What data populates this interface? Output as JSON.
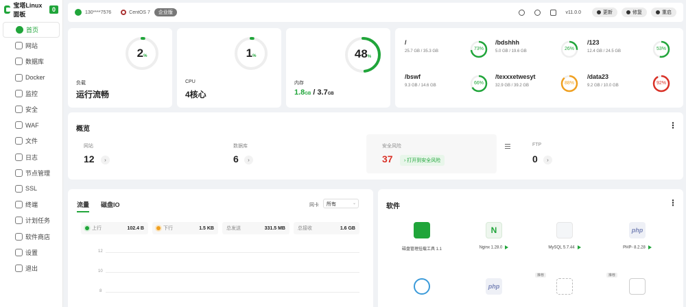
{
  "brand": {
    "name": "宝塔Linux面板",
    "badge": "0"
  },
  "sidebar": {
    "items": [
      {
        "label": "首页",
        "icon": "home-icon"
      },
      {
        "label": "网站",
        "icon": "website-icon"
      },
      {
        "label": "数据库",
        "icon": "database-icon"
      },
      {
        "label": "Docker",
        "icon": "docker-icon"
      },
      {
        "label": "监控",
        "icon": "monitor-icon"
      },
      {
        "label": "安全",
        "icon": "shield-icon"
      },
      {
        "label": "WAF",
        "icon": "waf-icon"
      },
      {
        "label": "文件",
        "icon": "file-icon"
      },
      {
        "label": "日志",
        "icon": "log-icon"
      },
      {
        "label": "节点管理",
        "icon": "node-icon"
      },
      {
        "label": "SSL",
        "icon": "ssl-icon"
      },
      {
        "label": "终端",
        "icon": "terminal-icon"
      },
      {
        "label": "计划任务",
        "icon": "calendar-icon"
      },
      {
        "label": "软件商店",
        "icon": "store-icon"
      },
      {
        "label": "设置",
        "icon": "gear-icon"
      },
      {
        "label": "退出",
        "icon": "logout-icon"
      }
    ]
  },
  "topbar": {
    "user": "130****7576",
    "os": "CentOS 7",
    "edition": "企业版",
    "version": "v11.0.0",
    "update_label": "更新",
    "repair_label": "修复",
    "restart_label": "重启"
  },
  "stats": {
    "load": {
      "percent": 2,
      "label": "负载",
      "status": "运行流畅"
    },
    "cpu": {
      "percent": 1,
      "label": "CPU",
      "cores": "4核心"
    },
    "memory": {
      "percent": 48,
      "label": "内存",
      "used": "1.8",
      "used_unit": "GB",
      "total": "3.7",
      "total_unit": "GB",
      "sep": " / "
    },
    "percent_sign": "%"
  },
  "disks": [
    {
      "name": "/",
      "size": "25.7 GB / 35.3 GB",
      "percent": 73,
      "color": "#20a53a"
    },
    {
      "name": "/bdshhh",
      "size": "5.0 GB / 19.6 GB",
      "percent": 26,
      "color": "#20a53a"
    },
    {
      "name": "/123",
      "size": "12.4 GB / 24.5 GB",
      "percent": 53,
      "color": "#20a53a"
    },
    {
      "name": "/bswf",
      "size": "9.3 GB / 14.6 GB",
      "percent": 66,
      "color": "#20a53a"
    },
    {
      "name": "/texxxetwesyt",
      "size": "32.9 GB / 39.2 GB",
      "percent": 88,
      "color": "#f0a020"
    },
    {
      "name": "/data23",
      "size": "9.2 GB / 10.0 GB",
      "percent": 92,
      "color": "#d93026"
    }
  ],
  "overview": {
    "title": "概览",
    "website": {
      "label": "网站",
      "value": "12"
    },
    "database": {
      "label": "数据库",
      "value": "6"
    },
    "risk": {
      "label": "安全风险",
      "value": "37",
      "button": "打开到安全风险",
      "color": "#d93026"
    },
    "ftp": {
      "label": "FTP",
      "value": "0"
    }
  },
  "traffic": {
    "tabs": [
      "流量",
      "磁盘IO"
    ],
    "nic_label": "网卡",
    "nic_value": "所有",
    "metrics": [
      {
        "label": "上行",
        "value": "102.4 B",
        "dot": "#20a53a"
      },
      {
        "label": "下行",
        "value": "1.5 KB",
        "dot": "#f0a020"
      },
      {
        "label": "总发送",
        "value": "331.5 MB"
      },
      {
        "label": "总接收",
        "value": "1.6 GB"
      }
    ],
    "y_ticks": [
      "12",
      "10",
      "8"
    ]
  },
  "software": {
    "title": "软件",
    "items": [
      {
        "name": "磁盘管理挂载工具 1.1",
        "icon": "disk-tool-icon",
        "play": false
      },
      {
        "name": "Nginx 1.28.0",
        "icon": "nginx-icon",
        "play": true
      },
      {
        "name": "MySQL 5.7.44",
        "icon": "mysql-icon",
        "play": true
      },
      {
        "name": "PHP- 8.2.28",
        "icon": "php-icon",
        "play": true
      },
      {
        "name": "",
        "icon": "network-icon",
        "play": false
      },
      {
        "name": "",
        "icon": "php-icon",
        "play": false
      },
      {
        "name": "",
        "icon": "file-sync-icon",
        "play": false,
        "badge": "推荐"
      },
      {
        "name": "",
        "icon": "app-icon",
        "play": false,
        "badge": "推荐"
      }
    ]
  }
}
